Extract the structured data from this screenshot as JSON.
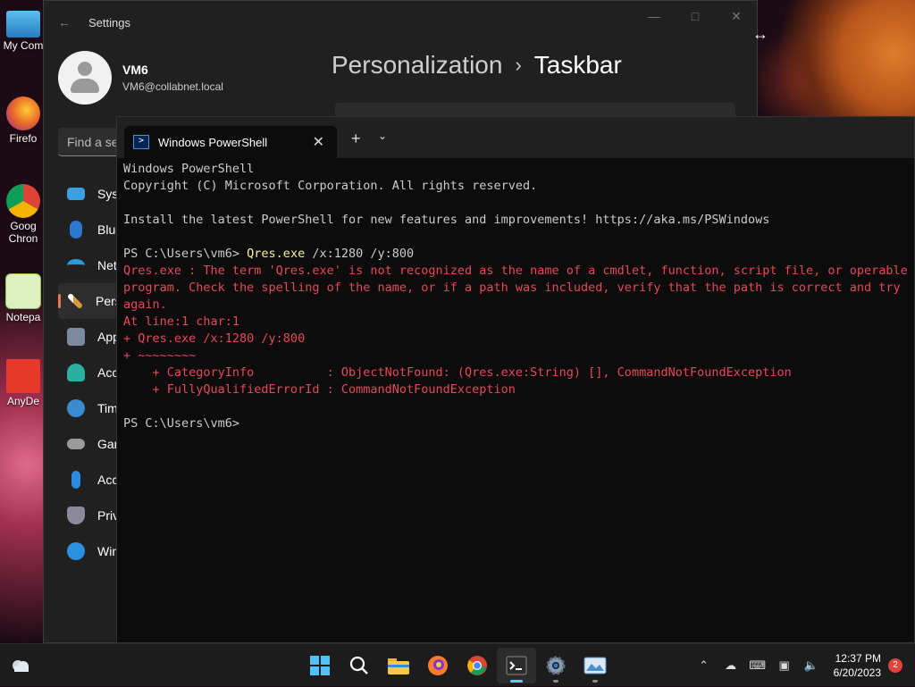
{
  "desktop": {
    "icons": [
      {
        "label": "My Com",
        "icon": "computer-icon",
        "color": "#3a9ad9"
      },
      {
        "label": "Firefo",
        "icon": "firefox-icon",
        "color": "#e8652a"
      },
      {
        "label": "Goog",
        "label2": "Chron",
        "icon": "chrome-icon",
        "color": "#2a8a3a"
      },
      {
        "label": "Notepa",
        "icon": "notepad-icon",
        "color": "#8ac04a"
      },
      {
        "label": "AnyDe",
        "icon": "anydesk-icon",
        "color": "#e8382a"
      }
    ]
  },
  "settings": {
    "title": "Settings",
    "user_name": "VM6",
    "user_email": "VM6@collabnet.local",
    "search_placeholder": "Find a se",
    "breadcrumb_parent": "Personalization",
    "breadcrumb_sep": "›",
    "breadcrumb_current": "Taskbar",
    "nav": [
      {
        "label": "Syst",
        "icon": "system-icon",
        "color": "#3aa0e0"
      },
      {
        "label": "Blue",
        "icon": "bluetooth-icon",
        "color": "#2a78d0"
      },
      {
        "label": "Net",
        "icon": "network-icon",
        "color": "#2a9ae0"
      },
      {
        "label": "Pers",
        "icon": "personalization-icon",
        "color": "#d89a3a",
        "active": true
      },
      {
        "label": "App",
        "icon": "apps-icon",
        "color": "#7a8aa0"
      },
      {
        "label": "Acc",
        "icon": "accounts-icon",
        "color": "#2ab0a0"
      },
      {
        "label": "Tim",
        "icon": "time-language-icon",
        "color": "#3a8ad0"
      },
      {
        "label": "Gar",
        "icon": "gaming-icon",
        "color": "#9a9a9a"
      },
      {
        "label": "Acc",
        "icon": "accessibility-icon",
        "color": "#2a8ae0"
      },
      {
        "label": "Priv",
        "icon": "privacy-icon",
        "color": "#8a8a9a"
      },
      {
        "label": "Win",
        "icon": "windows-update-icon",
        "color": "#2a90e0"
      }
    ]
  },
  "terminal": {
    "tab_title": "Windows PowerShell",
    "lines": [
      {
        "type": "normal",
        "text": "Windows PowerShell"
      },
      {
        "type": "normal",
        "text": "Copyright (C) Microsoft Corporation. All rights reserved."
      },
      {
        "type": "normal",
        "text": ""
      },
      {
        "type": "normal",
        "text": "Install the latest PowerShell for new features and improvements! https://aka.ms/PSWindows"
      },
      {
        "type": "normal",
        "text": ""
      },
      {
        "type": "prompt",
        "prompt": "PS C:\\Users\\vm6> ",
        "cmd": "Qres.exe",
        "args": " /x:1280 /y:800"
      },
      {
        "type": "err",
        "text": "Qres.exe : The term 'Qres.exe' is not recognized as the name of a cmdlet, function, script file, or operable"
      },
      {
        "type": "err",
        "text": "program. Check the spelling of the name, or if a path was included, verify that the path is correct and try"
      },
      {
        "type": "err",
        "text": "again."
      },
      {
        "type": "err",
        "text": "At line:1 char:1"
      },
      {
        "type": "err",
        "text": "+ Qres.exe /x:1280 /y:800"
      },
      {
        "type": "err",
        "text": "+ ~~~~~~~~"
      },
      {
        "type": "err",
        "text": "    + CategoryInfo          : ObjectNotFound: (Qres.exe:String) [], CommandNotFoundException"
      },
      {
        "type": "err",
        "text": "    + FullyQualifiedErrorId : CommandNotFoundException"
      },
      {
        "type": "normal",
        "text": ""
      },
      {
        "type": "normal",
        "text": "PS C:\\Users\\vm6>"
      }
    ]
  },
  "taskbar": {
    "apps": [
      {
        "name": "start-button",
        "icon": "windows-logo-icon",
        "active": false
      },
      {
        "name": "search-button",
        "icon": "search-icon",
        "active": false
      },
      {
        "name": "file-explorer-button",
        "icon": "folder-icon",
        "active": false
      },
      {
        "name": "firefox-button",
        "icon": "firefox-icon",
        "active": false
      },
      {
        "name": "chrome-button",
        "icon": "chrome-icon",
        "active": false
      },
      {
        "name": "terminal-button",
        "icon": "terminal-icon",
        "active": true
      },
      {
        "name": "settings-button",
        "icon": "gear-icon",
        "active": false
      },
      {
        "name": "photos-button",
        "icon": "photos-icon",
        "active": false
      }
    ],
    "time": "12:37 PM",
    "date": "6/20/2023",
    "notification_count": "2"
  }
}
